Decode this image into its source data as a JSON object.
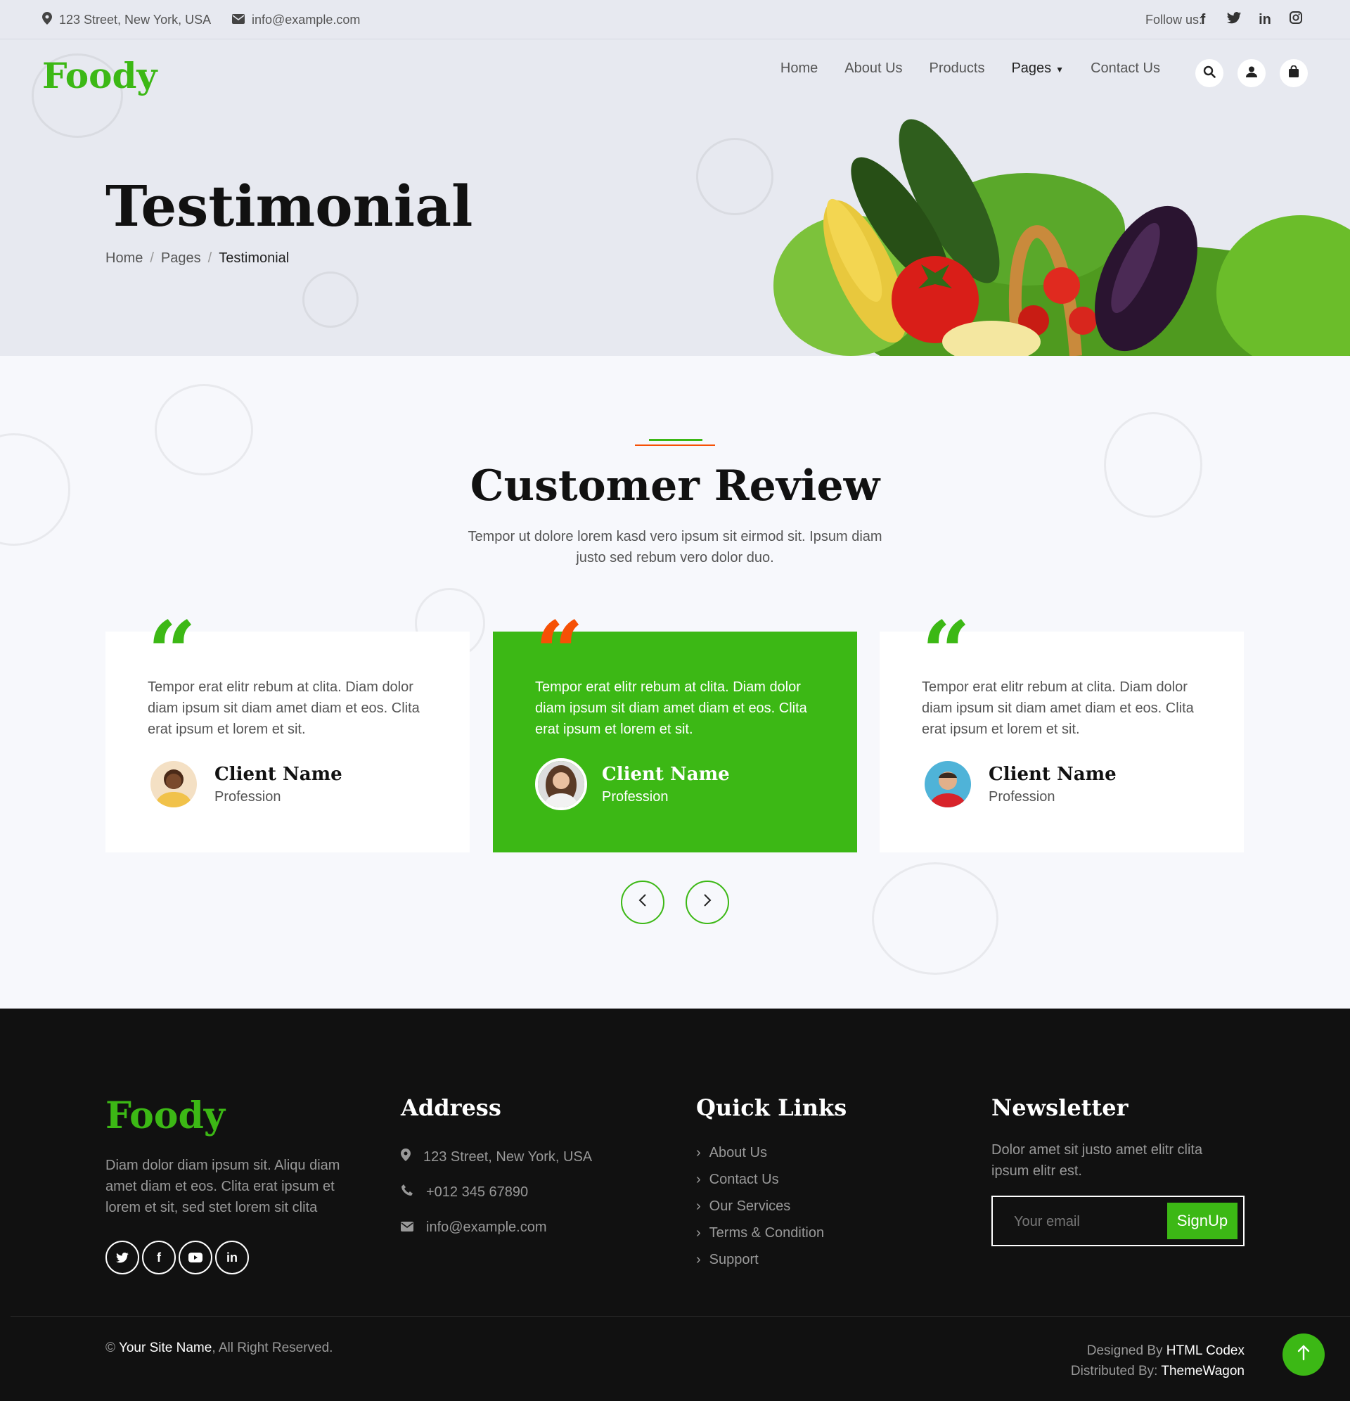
{
  "topbar": {
    "address": "123 Street, New York, USA",
    "email": "info@example.com",
    "follow_label": "Follow us:",
    "social_icons": [
      "facebook-icon",
      "twitter-icon",
      "linkedin-icon",
      "instagram-icon"
    ]
  },
  "header": {
    "logo": "Foody",
    "nav": [
      "Home",
      "About Us",
      "Products",
      "Pages",
      "Contact Us"
    ],
    "active_nav": "Pages",
    "icons": [
      "search-icon",
      "user-icon",
      "bag-icon"
    ]
  },
  "hero": {
    "title": "Testimonial",
    "breadcrumb": [
      "Home",
      "Pages",
      "Testimonial"
    ]
  },
  "reviews": {
    "title": "Customer Review",
    "subtitle": "Tempor ut dolore lorem kasd vero ipsum sit eirmod sit. Ipsum diam justo sed rebum vero dolor duo.",
    "cards": [
      {
        "text": "Tempor erat elitr rebum at clita. Diam dolor diam ipsum sit diam amet diam et eos. Clita erat ipsum et lorem et sit.",
        "name": "Client Name",
        "profession": "Profession"
      },
      {
        "text": "Tempor erat elitr rebum at clita. Diam dolor diam ipsum sit diam amet diam et eos. Clita erat ipsum et lorem et sit.",
        "name": "Client Name",
        "profession": "Profession"
      },
      {
        "text": "Tempor erat elitr rebum at clita. Diam dolor diam ipsum sit diam amet diam et eos. Clita erat ipsum et lorem et sit.",
        "name": "Client Name",
        "profession": "Profession"
      }
    ]
  },
  "footer": {
    "logo": "Foody",
    "about": "Diam dolor diam ipsum sit. Aliqu diam amet diam et eos. Clita erat ipsum et lorem et sit, sed stet lorem sit clita",
    "address_title": "Address",
    "address": "123 Street, New York, USA",
    "phone": "+012 345 67890",
    "email": "info@example.com",
    "links_title": "Quick Links",
    "links": [
      "About Us",
      "Contact Us",
      "Our Services",
      "Terms & Condition",
      "Support"
    ],
    "newsletter_title": "Newsletter",
    "newsletter_text": "Dolor amet sit justo amet elitr clita ipsum elitr est.",
    "email_placeholder": "Your email",
    "signup_label": "SignUp",
    "copyright_prefix": "©",
    "site_name": "Your Site Name",
    "rights": ", All Right Reserved.",
    "designed_by_label": "Designed By",
    "designed_by": "HTML Codex",
    "distributed_by_label": "Distributed By:",
    "distributed_by": "ThemeWagon"
  },
  "colors": {
    "primary": "#3cb815",
    "secondary": "#f65005",
    "dark": "#111111",
    "light": "#e7e9f0"
  }
}
